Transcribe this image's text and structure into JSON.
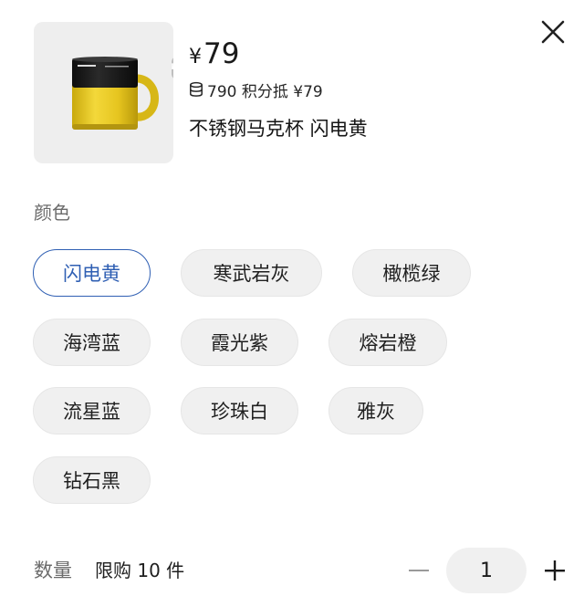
{
  "product": {
    "currency": "¥",
    "price": "79",
    "points_text": "790 积分抵 ¥79",
    "title": "不锈钢马克杯 闪电黄",
    "image_label": "product-mug-image"
  },
  "color_section": {
    "label": "颜色",
    "options": [
      {
        "label": "闪电黄",
        "selected": true
      },
      {
        "label": "寒武岩灰",
        "selected": false
      },
      {
        "label": "橄榄绿",
        "selected": false
      },
      {
        "label": "海湾蓝",
        "selected": false
      },
      {
        "label": "霞光紫",
        "selected": false
      },
      {
        "label": "熔岩橙",
        "selected": false
      },
      {
        "label": "流星蓝",
        "selected": false
      },
      {
        "label": "珍珠白",
        "selected": false
      },
      {
        "label": "雅灰",
        "selected": false
      },
      {
        "label": "钻石黑",
        "selected": false
      }
    ]
  },
  "quantity": {
    "label": "数量",
    "limit_text": "限购 10 件",
    "value": "1"
  },
  "icons": {
    "close": "close-icon",
    "expand": "expand-icon",
    "points": "coin-stack-icon",
    "minus": "minus-icon",
    "plus": "plus-icon"
  },
  "colors": {
    "accent": "#2f5fb3",
    "mug_yellow": "#e2c21b",
    "mug_black": "#151515",
    "chip_bg": "#f0f0f0"
  }
}
